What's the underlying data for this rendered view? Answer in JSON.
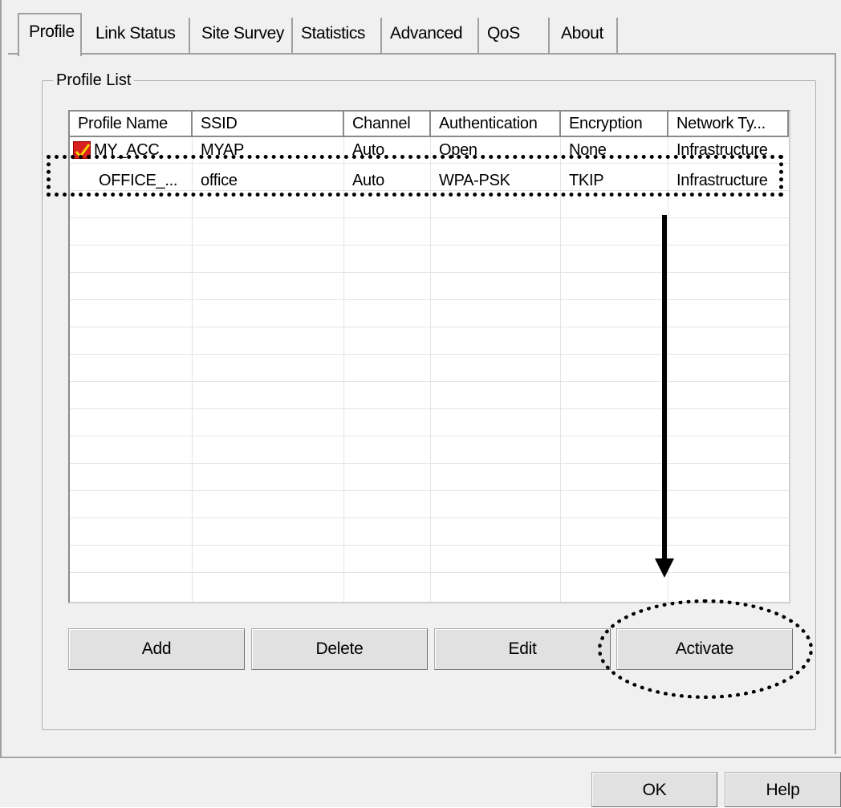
{
  "tabs": [
    {
      "label": "Profile",
      "active": true
    },
    {
      "label": "Link Status"
    },
    {
      "label": "Site Survey"
    },
    {
      "label": "Statistics"
    },
    {
      "label": "Advanced"
    },
    {
      "label": "QoS"
    },
    {
      "label": "About"
    }
  ],
  "profile_list": {
    "title": "Profile List",
    "columns": [
      "Profile Name",
      "SSID",
      "Channel",
      "Authentication",
      "Encryption",
      "Network Ty..."
    ],
    "rows": [
      {
        "name": "MY_ACC",
        "ssid": "MYAP",
        "channel": "Auto",
        "auth": "Open",
        "encryption": "None",
        "network_type": "Infrastructure",
        "active_icon": "checkmark-icon"
      },
      {
        "name": "OFFICE_...",
        "ssid": "office",
        "channel": "Auto",
        "auth": "WPA-PSK",
        "encryption": "TKIP",
        "network_type": "Infrastructure"
      }
    ]
  },
  "buttons": {
    "add": "Add",
    "delete": "Delete",
    "edit": "Edit",
    "activate": "Activate"
  },
  "footer": {
    "ok": "OK",
    "help": "Help"
  },
  "colors": {
    "active_icon": "#d81e1e",
    "annotation": "#000000"
  }
}
